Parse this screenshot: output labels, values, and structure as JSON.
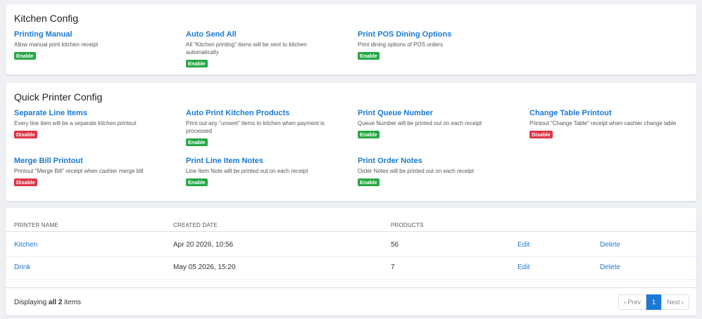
{
  "kitchen_config": {
    "title": "Kitchen Config",
    "options": [
      {
        "title": "Printing Manual",
        "desc": "Allow manual print kitchen receipt",
        "status": "Enable"
      },
      {
        "title": "Auto Send All",
        "desc": "All \"Kitchen printing\" items will be sent to kitchen automatically",
        "status": "Enable"
      },
      {
        "title": "Print POS Dining Options",
        "desc": "Print dining options of POS orders",
        "status": "Enable"
      }
    ]
  },
  "quick_printer_config": {
    "title": "Quick Printer Config",
    "options": [
      {
        "title": "Separate Line Items",
        "desc": "Every line item will be a separate kitchen printout",
        "status": "Disable"
      },
      {
        "title": "Auto Print Kitchen Products",
        "desc": "Print out any \"unsent\" items to kitchen when payment is processed",
        "status": "Enable"
      },
      {
        "title": "Print Queue Number",
        "desc": "Queue Number will be printed out on each receipt",
        "status": "Enable"
      },
      {
        "title": "Change Table Printout",
        "desc": "Printout \"Change Table\" receipt when cashier change table",
        "status": "Disable"
      },
      {
        "title": "Merge Bill Printout",
        "desc": "Printout \"Merge Bill\" receipt when cashier merge bill",
        "status": "Disable"
      },
      {
        "title": "Print Line Item Notes",
        "desc": "Line Item Note will be printed out on each receipt",
        "status": "Enable"
      },
      {
        "title": "Print Order Notes",
        "desc": "Order Notes will be printed out on each receipt",
        "status": "Enable"
      }
    ]
  },
  "printers": {
    "columns": [
      "PRINTER NAME",
      "CREATED DATE",
      "PRODUCTS"
    ],
    "rows": [
      {
        "name": "Kitchen",
        "created": "Apr 20 2026, 10:56",
        "products": "56",
        "edit": "Edit",
        "delete": "Delete"
      },
      {
        "name": "Drink",
        "created": "May 05 2026, 15:20",
        "products": "7",
        "edit": "Edit",
        "delete": "Delete"
      }
    ],
    "footer": {
      "display_prefix": "Displaying ",
      "display_bold": "all 2",
      "display_suffix": " items",
      "prev": "‹ Prev",
      "page": "1",
      "next": "Next ›"
    }
  },
  "colors": {
    "link": "#1a7ad4",
    "enable": "#28a745",
    "disable": "#dc3545"
  }
}
